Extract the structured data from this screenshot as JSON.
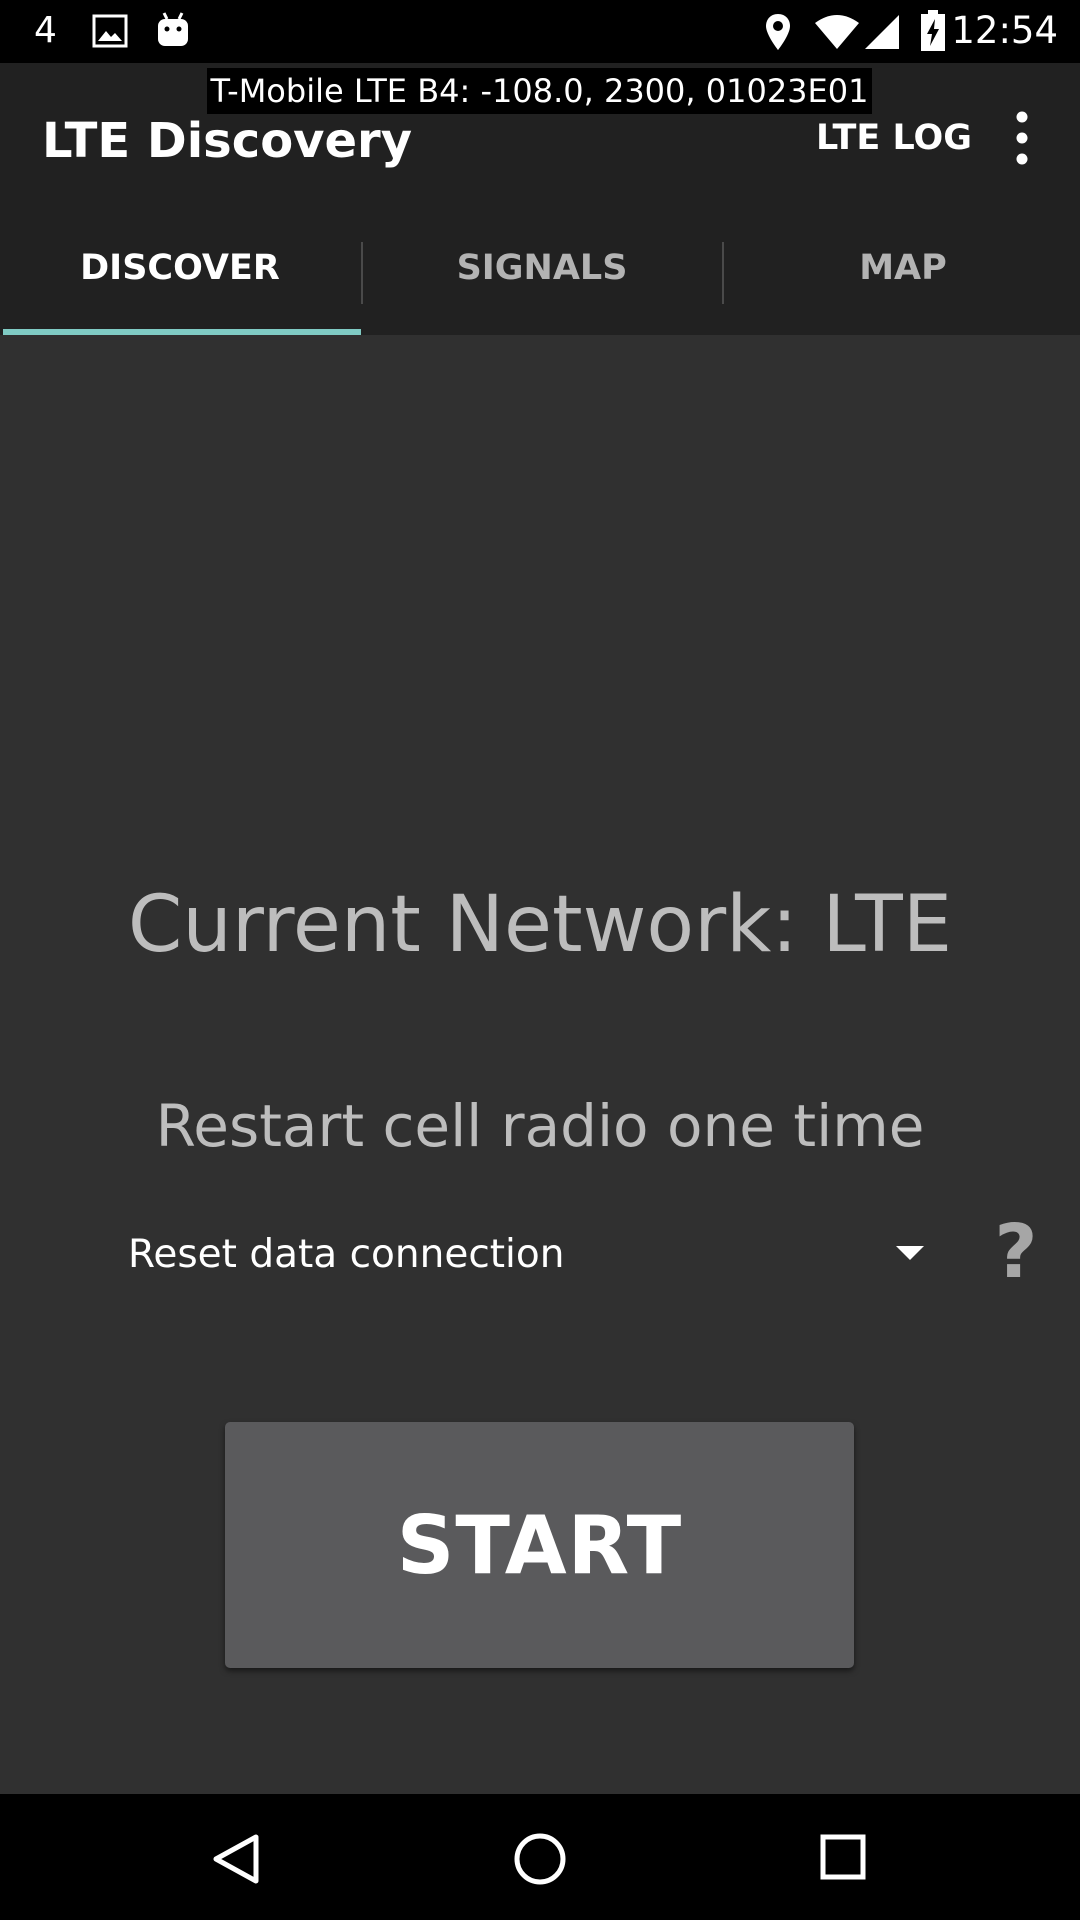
{
  "status_bar": {
    "notification_count": "4",
    "time": "12:54",
    "icons": [
      "image-icon",
      "android-icon",
      "location-icon",
      "wifi-icon",
      "cell-signal-icon",
      "battery-charging-icon"
    ]
  },
  "signal_overlay": {
    "text": "T-Mobile LTE B4: -108.0, 2300, 01023E01"
  },
  "app_bar": {
    "title": "LTE Discovery",
    "action_label": "LTE LOG",
    "overflow_icon": "more-vert-icon"
  },
  "tabs": [
    {
      "label": "DISCOVER",
      "selected": true
    },
    {
      "label": "SIGNALS",
      "selected": false
    },
    {
      "label": "MAP",
      "selected": false
    }
  ],
  "main": {
    "network_status": "Current Network: LTE",
    "restart_label": "Restart cell radio one time",
    "spinner_value": "Reset data connection",
    "help_icon": "?",
    "start_label": "START"
  },
  "nav_bar": {
    "icons": [
      "back-icon",
      "home-icon",
      "recents-icon"
    ]
  },
  "colors": {
    "background": "#303030",
    "app_bar": "#212121",
    "accent": "#80CBC4",
    "tab_selected_text": "#ffffff",
    "tab_unselected_text": "#b3b3b3",
    "button": "#5a5a5c",
    "status_bar": "#000000"
  }
}
